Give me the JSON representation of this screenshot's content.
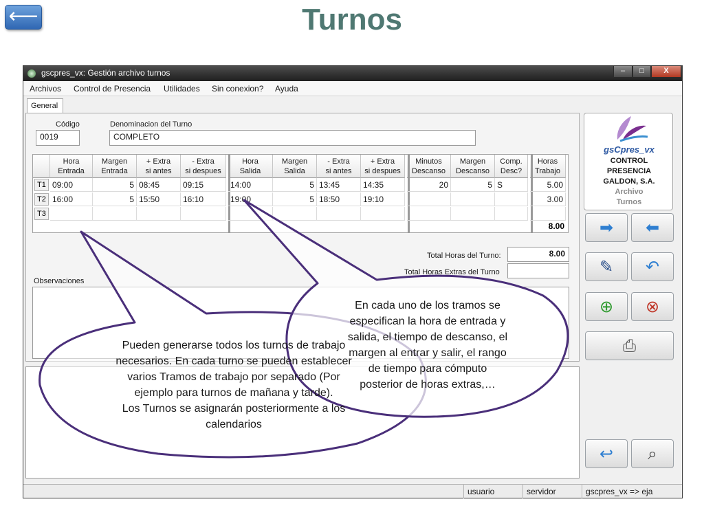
{
  "slide": {
    "title": "Turnos",
    "back_glyph": "⟵"
  },
  "window": {
    "title": "gscpres_vx: Gestión archivo turnos",
    "controls": {
      "minimize": "–",
      "maximize": "□",
      "close": "X"
    },
    "menu": [
      "Archivos",
      "Control de Presencia",
      "Utilidades",
      "Sin conexion?",
      "Ayuda"
    ],
    "tab": "General"
  },
  "form": {
    "codigo_label": "Código",
    "codigo_value": "0019",
    "denominacion_label": "Denominacion del Turno",
    "denominacion_value": "COMPLETO",
    "observaciones_label": "Observaciones",
    "total_horas_label": "Total Horas del Turno:",
    "total_horas_value": "8.00",
    "total_extras_label": "Total Horas Extras del Turno",
    "total_extras_value": ""
  },
  "grid": {
    "headers": [
      [
        "Hora",
        "Entrada"
      ],
      [
        "Margen",
        "Entrada"
      ],
      [
        "+ Extra",
        "si antes"
      ],
      [
        "- Extra",
        "si despues"
      ],
      [
        "Hora",
        "Salida"
      ],
      [
        "Margen",
        "Salida"
      ],
      [
        "- Extra",
        "si antes"
      ],
      [
        "+ Extra",
        "si despues"
      ],
      [
        "Minutos",
        "Descanso"
      ],
      [
        "Margen",
        "Descanso"
      ],
      [
        "Comp.",
        "Desc?"
      ],
      [
        "Horas",
        "Trabajo"
      ]
    ],
    "rows": [
      {
        "label": "T1",
        "cells": [
          "09:00",
          "5",
          "08:45",
          "09:15",
          "14:00",
          "5",
          "13:45",
          "14:35",
          "20",
          "5",
          "S",
          "5.00"
        ]
      },
      {
        "label": "T2",
        "cells": [
          "16:00",
          "5",
          "15:50",
          "16:10",
          "19:00",
          "5",
          "18:50",
          "19:10",
          "",
          "",
          "",
          "3.00"
        ]
      },
      {
        "label": "T3",
        "cells": [
          "",
          "",
          "",
          "",
          "",
          "",
          "",
          "",
          "",
          "",
          "",
          ""
        ]
      }
    ],
    "total": "8.00"
  },
  "logo": {
    "brand": "gsCpres_vx",
    "lines": [
      "CONTROL",
      "PRESENCIA",
      "GALDON, S.A."
    ],
    "sub_lines": [
      "Archivo",
      "Turnos"
    ],
    "accent": "#7a2f8f"
  },
  "toolbar_icons": [
    "arrow-right-icon",
    "arrow-left-icon",
    "edit-document-icon",
    "undo-document-icon",
    "add-database-icon",
    "delete-database-icon",
    "print-icon",
    "return-icon",
    "search-records-icon"
  ],
  "status": {
    "user": "usuario",
    "server": "servidor",
    "app": "gscpres_vx => eja"
  },
  "bubbles": {
    "left": [
      "Pueden generarse todos los turnos de trabajo",
      "necesarios. En cada turno se pueden establecer",
      "varios Tramos de trabajo por separado (Por",
      "ejemplo para turnos de mañana y tarde).",
      "Los Turnos se asignarán posteriormente a los",
      "calendarios"
    ],
    "right": [
      "En cada uno de los tramos se",
      "especifican la hora de entrada y",
      "salida, el tiempo de descanso, el",
      "margen al entrar y salir, el rango",
      "de tiempo para cómputo",
      "posterior de horas extras,…"
    ]
  }
}
